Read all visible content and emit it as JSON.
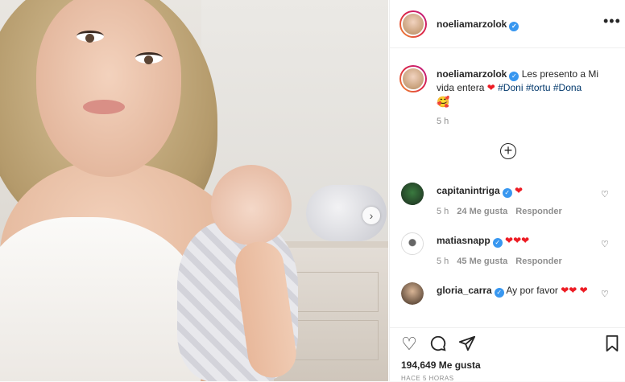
{
  "post": {
    "username": "noeliamarzolok",
    "caption": "Les presento a Mi vida entera",
    "caption_hashtags": [
      "#Doni",
      "#tortu",
      "#Dona"
    ],
    "caption_time": "5 h",
    "likes": "194,649 Me gusta",
    "time_ago": "HACE 5 HORAS"
  },
  "comments": [
    {
      "username": "capitanintriga",
      "text": "",
      "time": "5 h",
      "likes": "24 Me gusta",
      "reply": "Responder"
    },
    {
      "username": "matiasnapp",
      "text": "",
      "time": "5 h",
      "likes": "45 Me gusta",
      "reply": "Responder"
    },
    {
      "username": "gloria_carra",
      "text": "Ay por favor",
      "time": "",
      "likes": "",
      "reply": ""
    }
  ],
  "icons": {
    "verified": "verified-badge",
    "more": "more-options-icon",
    "add": "add-comment-plus-icon",
    "like": "heart-outline-icon",
    "comment": "comment-bubble-icon",
    "share": "paper-plane-icon",
    "save": "bookmark-icon",
    "next": "chevron-right-icon"
  },
  "colors": {
    "accent": "#3897f0",
    "heart": "#ed1c24",
    "hashtag": "#00376b",
    "muted": "#8e8e8e"
  }
}
